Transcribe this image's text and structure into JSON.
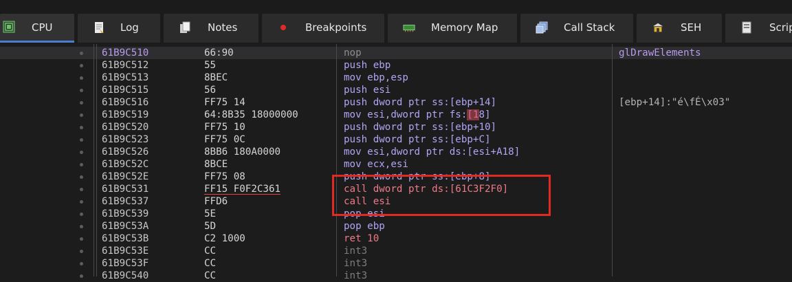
{
  "tabs": [
    {
      "label": "CPU",
      "icon": "cpu-icon",
      "active": true
    },
    {
      "label": "Log",
      "icon": "log-icon"
    },
    {
      "label": "Notes",
      "icon": "notes-icon"
    },
    {
      "label": "Breakpoints",
      "icon": "breakpoint-icon"
    },
    {
      "label": "Memory Map",
      "icon": "memory-map-icon"
    },
    {
      "label": "Call Stack",
      "icon": "call-stack-icon"
    },
    {
      "label": "SEH",
      "icon": "seh-icon"
    },
    {
      "label": "Scrip",
      "icon": "script-icon"
    }
  ],
  "disassembly": {
    "rows": [
      {
        "addr": "61B9C510",
        "bytes": "66:90",
        "instr": "nop",
        "comment": "glDrawElements",
        "selected": true
      },
      {
        "addr": "61B9C512",
        "bytes": "55",
        "instr": "push ebp",
        "comment": ""
      },
      {
        "addr": "61B9C513",
        "bytes": "8BEC",
        "instr": "mov ebp,esp",
        "comment": ""
      },
      {
        "addr": "61B9C515",
        "bytes": "56",
        "instr": "push esi",
        "comment": ""
      },
      {
        "addr": "61B9C516",
        "bytes": "FF75 14",
        "instr": "push dword ptr ss:[ebp+14]",
        "comment": "[ebp+14]:\"é\\fÉ\\x03\""
      },
      {
        "addr": "61B9C519",
        "bytes": "64:8B35 18000000",
        "instr": "mov esi,dword ptr fs:[18]",
        "comment": ""
      },
      {
        "addr": "61B9C520",
        "bytes": "FF75 10",
        "instr": "push dword ptr ss:[ebp+10]",
        "comment": ""
      },
      {
        "addr": "61B9C523",
        "bytes": "FF75 0C",
        "instr": "push dword ptr ss:[ebp+C]",
        "comment": ""
      },
      {
        "addr": "61B9C526",
        "bytes": "8BB6 180A0000",
        "instr": "mov esi,dword ptr ds:[esi+A18]",
        "comment": ""
      },
      {
        "addr": "61B9C52C",
        "bytes": "8BCE",
        "instr": "mov ecx,esi",
        "comment": ""
      },
      {
        "addr": "61B9C52E",
        "bytes": "FF75 08",
        "instr": "push dword ptr ss:[ebp+8]",
        "comment": ""
      },
      {
        "addr": "61B9C531",
        "bytes": "FF15 F0F2C361",
        "instr": "call dword ptr ds:[61C3F2F0]",
        "comment": ""
      },
      {
        "addr": "61B9C537",
        "bytes": "FFD6",
        "instr": "call esi",
        "comment": ""
      },
      {
        "addr": "61B9C539",
        "bytes": "5E",
        "instr": "pop esi",
        "comment": ""
      },
      {
        "addr": "61B9C53A",
        "bytes": "5D",
        "instr": "pop ebp",
        "comment": ""
      },
      {
        "addr": "61B9C53B",
        "bytes": "C2 1000",
        "instr": "ret 10",
        "comment": ""
      },
      {
        "addr": "61B9C53E",
        "bytes": "CC",
        "instr": "int3",
        "comment": ""
      },
      {
        "addr": "61B9C53F",
        "bytes": "CC",
        "instr": "int3",
        "comment": ""
      },
      {
        "addr": "61B9C540",
        "bytes": "CC",
        "instr": "int3",
        "comment": ""
      }
    ]
  },
  "colors": {
    "accent_tab": "#4a7fd0",
    "highlight_box": "#e02a22",
    "call_color": "#f07a8a",
    "register_color": "#b0a6f6"
  }
}
